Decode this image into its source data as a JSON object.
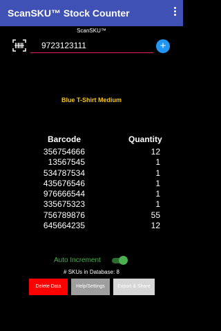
{
  "app": {
    "title": "ScanSKU™ Stock Counter",
    "subtitle": "ScanSKU™"
  },
  "scan": {
    "input_value": "9723123111",
    "add_label": "+"
  },
  "product": {
    "name": "Blue T-Shirt Medium"
  },
  "table": {
    "headers": {
      "barcode": "Barcode",
      "quantity": "Quantity"
    },
    "rows": [
      {
        "barcode": "356754666",
        "qty": "12"
      },
      {
        "barcode": "13567545",
        "qty": "1"
      },
      {
        "barcode": "534787534",
        "qty": "1"
      },
      {
        "barcode": "435676546",
        "qty": "1"
      },
      {
        "barcode": "976666544",
        "qty": "1"
      },
      {
        "barcode": "335675323",
        "qty": "1"
      },
      {
        "barcode": "756789876",
        "qty": "55"
      },
      {
        "barcode": "645664235",
        "qty": "12"
      }
    ]
  },
  "settings": {
    "auto_increment_label": "Auto Increment",
    "auto_increment_on": true,
    "db_count": "# SKUs in Database: 8"
  },
  "buttons": {
    "delete": "Delete Data",
    "help": "Help/Settings",
    "export": "Export & Share"
  },
  "colors": {
    "appbar": "#3f51b5",
    "accent_pink": "#e91e63",
    "fab_blue": "#2196f3",
    "product_yellow": "#f5c518",
    "toggle_green": "#4caf50",
    "delete_red": "#ff0000"
  },
  "icons": {
    "scan": "barcode-scan-icon",
    "overflow": "more-vert-icon",
    "add": "plus-icon"
  }
}
